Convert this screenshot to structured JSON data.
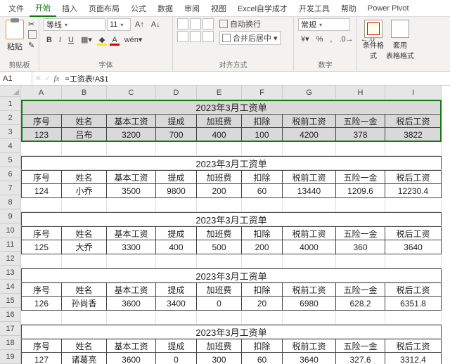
{
  "menu": {
    "file": "文件",
    "home": "开始",
    "insert": "插入",
    "layout": "页面布局",
    "formulas": "公式",
    "data": "数据",
    "review": "审阅",
    "view": "视图",
    "learn": "Excel自学成才",
    "dev": "开发工具",
    "help": "帮助",
    "pp": "Power Pivot"
  },
  "ribbon": {
    "clipboard": {
      "paste": "粘贴",
      "label": "剪贴板"
    },
    "font": {
      "name": "等线",
      "size": "11",
      "label": "字体",
      "bold": "B",
      "italic": "I",
      "underline": "U"
    },
    "align": {
      "wrap": "自动换行",
      "merge": "合并后居中",
      "label": "对齐方式"
    },
    "number": {
      "format": "常规",
      "label": "数字"
    },
    "styles": {
      "cond": "条件格式",
      "tbl": "套用\n表格格式"
    }
  },
  "namebox": "A1",
  "fx": "fx",
  "formula": "=工资表!A$1",
  "cols": [
    "A",
    "B",
    "C",
    "D",
    "E",
    "F",
    "G",
    "H",
    "I"
  ],
  "rownums": [
    "1",
    "2",
    "3",
    "4",
    "5",
    "6",
    "7",
    "8",
    "9",
    "10",
    "11",
    "12",
    "13",
    "14",
    "15",
    "16",
    "17",
    "18",
    "19"
  ],
  "title": "2023年3月工资单",
  "headers": [
    "序号",
    "姓名",
    "基本工资",
    "提成",
    "加班费",
    "扣除",
    "税前工资",
    "五险一金",
    "税后工资"
  ],
  "records": [
    [
      "123",
      "吕布",
      "3200",
      "700",
      "400",
      "100",
      "4200",
      "378",
      "3822"
    ],
    [
      "124",
      "小乔",
      "3500",
      "9800",
      "200",
      "60",
      "13440",
      "1209.6",
      "12230.4"
    ],
    [
      "125",
      "大乔",
      "3300",
      "400",
      "500",
      "200",
      "4000",
      "360",
      "3640"
    ],
    [
      "126",
      "孙尚香",
      "3600",
      "3400",
      "0",
      "20",
      "6980",
      "628.2",
      "6351.8"
    ],
    [
      "127",
      "诸葛亮",
      "3600",
      "0",
      "300",
      "60",
      "3640",
      "327.6",
      "3312.4"
    ]
  ]
}
